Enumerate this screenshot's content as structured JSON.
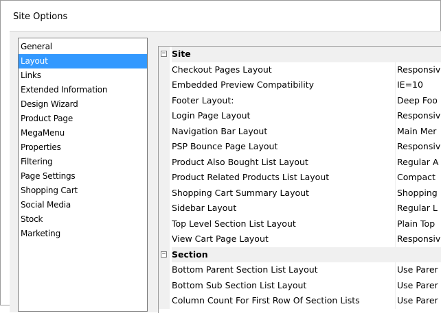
{
  "window": {
    "title": "Site Options"
  },
  "nav": {
    "items": [
      {
        "label": "General",
        "selected": false
      },
      {
        "label": "Layout",
        "selected": true
      },
      {
        "label": "Links",
        "selected": false
      },
      {
        "label": "Extended Information",
        "selected": false
      },
      {
        "label": "Design Wizard",
        "selected": false
      },
      {
        "label": "Product Page",
        "selected": false
      },
      {
        "label": "MegaMenu",
        "selected": false
      },
      {
        "label": "Properties",
        "selected": false
      },
      {
        "label": "Filtering",
        "selected": false
      },
      {
        "label": "Page Settings",
        "selected": false
      },
      {
        "label": "Shopping Cart",
        "selected": false
      },
      {
        "label": "Social Media",
        "selected": false
      },
      {
        "label": "Stock",
        "selected": false
      },
      {
        "label": "Marketing",
        "selected": false
      }
    ]
  },
  "grid": {
    "categories": [
      {
        "name": "Site",
        "expander": "−",
        "properties": [
          {
            "name": "Checkout Pages Layout",
            "value": "Responsiv"
          },
          {
            "name": "Embedded Preview Compatibility",
            "value": "IE=10"
          },
          {
            "name": "Footer Layout:",
            "value": "Deep Foo"
          },
          {
            "name": "Login Page Layout",
            "value": "Responsiv"
          },
          {
            "name": "Navigation Bar Layout",
            "value": "Main Mer"
          },
          {
            "name": "PSP Bounce Page Layout",
            "value": "Responsiv"
          },
          {
            "name": "Product Also Bought List Layout",
            "value": "Regular A"
          },
          {
            "name": "Product Related Products List Layout",
            "value": "Compact"
          },
          {
            "name": "Shopping Cart Summary Layout",
            "value": "Shopping"
          },
          {
            "name": "Sidebar Layout",
            "value": "Regular L"
          },
          {
            "name": "Top Level Section List Layout",
            "value": "Plain Top"
          },
          {
            "name": "View Cart Page Layout",
            "value": "Responsiv"
          }
        ]
      },
      {
        "name": "Section",
        "expander": "−",
        "properties": [
          {
            "name": "Bottom Parent Section List Layout",
            "value": "Use Parer"
          },
          {
            "name": "Bottom Sub Section List Layout",
            "value": "Use Parer"
          },
          {
            "name": "Column Count For First Row Of Section Lists",
            "value": "Use Parer"
          }
        ]
      }
    ]
  }
}
